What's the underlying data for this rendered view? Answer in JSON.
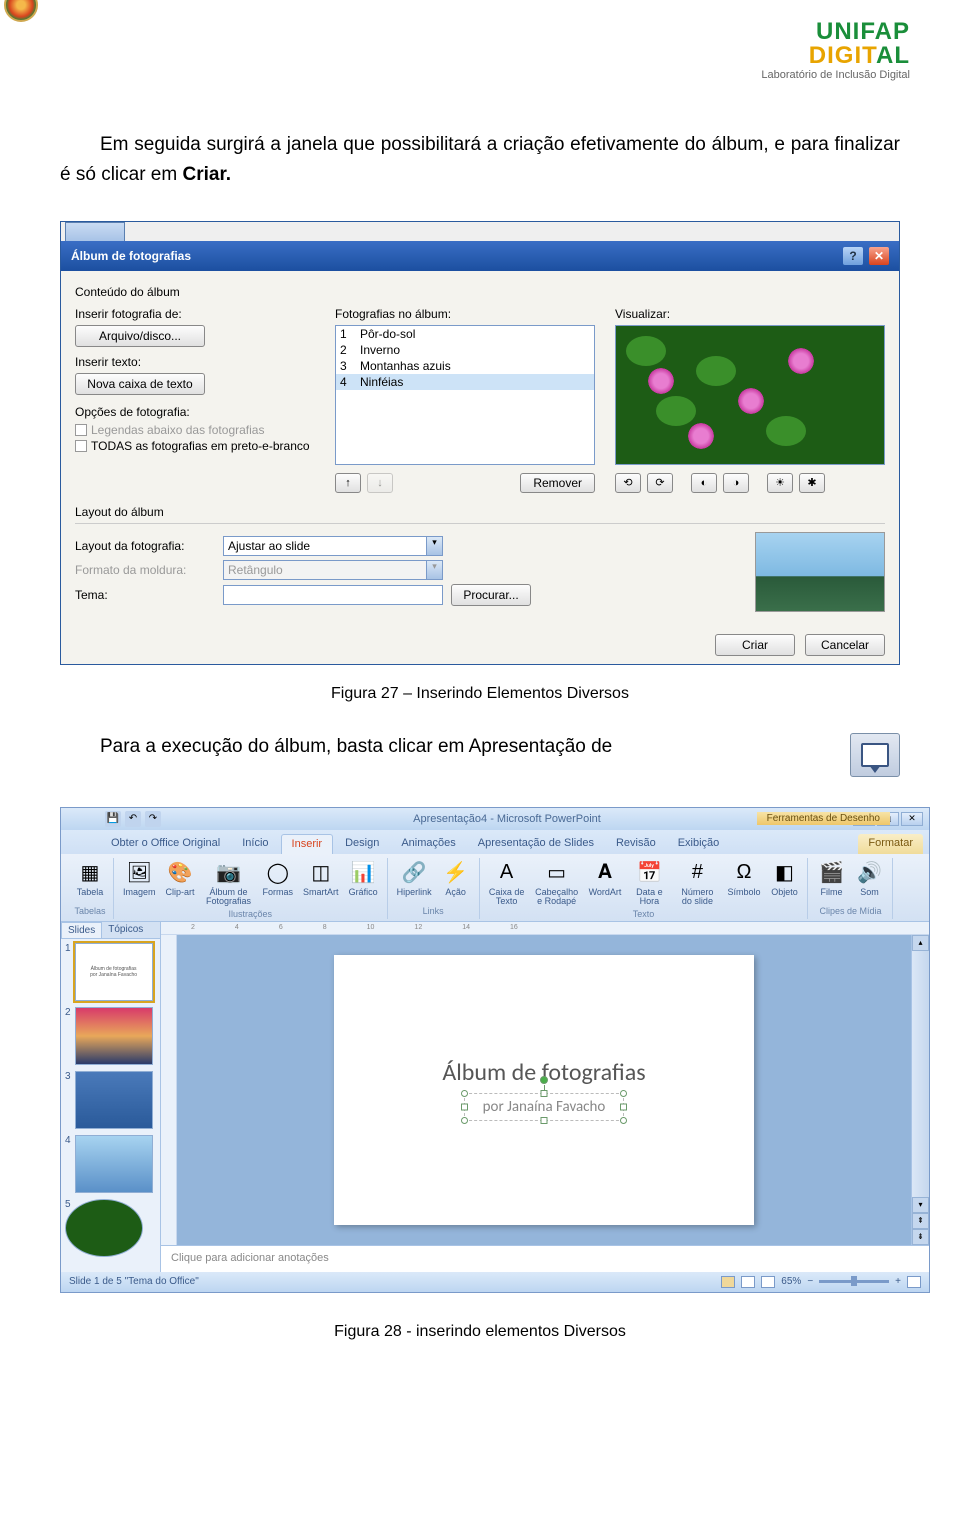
{
  "header": {
    "logo_line1": "UNIFAP",
    "logo_line2_pre": "DIGIT",
    "logo_line2_suf": "AL",
    "subtitle": "Laboratório de Inclusão Digital"
  },
  "paragraph1_pre": "Em seguida surgirá a janela que possibilitará a criação efetivamente do álbum, e para finalizar é só clicar em ",
  "paragraph1_bold": "Criar.",
  "figure27_caption": "Figura 27 – Inserindo Elementos Diversos",
  "paragraph2": "Para a execução do álbum, basta clicar em Apresentação de",
  "figure28_caption": "Figura 28 - inserindo elementos Diversos",
  "dialog": {
    "title": "Álbum de fotografias",
    "groups": {
      "contents": "Conteúdo do álbum",
      "insert_from": "Inserir fotografia de:",
      "insert_text": "Inserir texto:",
      "options": "Opções de fotografia:",
      "photos_in_album": "Fotografias no álbum:",
      "preview": "Visualizar:",
      "layout": "Layout do álbum"
    },
    "buttons": {
      "file": "Arquivo/disco...",
      "newtext": "Nova caixa de texto",
      "remove": "Remover",
      "browse": "Procurar...",
      "create": "Criar",
      "cancel": "Cancelar"
    },
    "checkboxes": {
      "captions": "Legendas abaixo das fotografias",
      "bw": "TODAS as fotografias em preto-e-branco"
    },
    "list": [
      {
        "n": "1",
        "name": "Pôr-do-sol"
      },
      {
        "n": "2",
        "name": "Inverno"
      },
      {
        "n": "3",
        "name": "Montanhas azuis"
      },
      {
        "n": "4",
        "name": "Ninféias"
      }
    ],
    "layout_labels": {
      "picture": "Layout da fotografia:",
      "frame": "Formato da moldura:",
      "theme": "Tema:"
    },
    "layout_values": {
      "picture": "Ajustar ao slide",
      "frame": "Retângulo"
    },
    "arrow_up": "↑",
    "arrow_down": "↓"
  },
  "ppt": {
    "title": "Apresentação4 - Microsoft PowerPoint",
    "context_tab_title": "Ferramentas de Desenho",
    "tabs": [
      "Obter o Office Original",
      "Início",
      "Inserir",
      "Design",
      "Animações",
      "Apresentação de Slides",
      "Revisão",
      "Exibição"
    ],
    "format_tab": "Formatar",
    "ribbon_groups": {
      "tabelas": {
        "label": "Tabelas",
        "items": [
          "Tabela"
        ]
      },
      "ilustracoes": {
        "label": "Ilustrações",
        "items": [
          "Imagem",
          "Clip-art",
          "Álbum de Fotografias",
          "Formas",
          "SmartArt",
          "Gráfico"
        ]
      },
      "links": {
        "label": "Links",
        "items": [
          "Hiperlink",
          "Ação"
        ]
      },
      "texto": {
        "label": "Texto",
        "items": [
          "Caixa de Texto",
          "Cabeçalho e Rodapé",
          "WordArt",
          "Data e Hora",
          "Número do slide",
          "Símbolo",
          "Objeto"
        ]
      },
      "clipes": {
        "label": "Clipes de Mídia",
        "items": [
          "Filme",
          "Som"
        ]
      }
    },
    "left_tabs": {
      "slides": "Slides",
      "topics": "Tópicos"
    },
    "thumbs": [
      {
        "n": "1",
        "variant": "title",
        "t1": "Álbum de fotografias",
        "t2": "por Janaína Favacho"
      },
      {
        "n": "2",
        "variant": "sunset"
      },
      {
        "n": "3",
        "variant": "water"
      },
      {
        "n": "4",
        "variant": "sky"
      },
      {
        "n": "5",
        "variant": "lily"
      }
    ],
    "slide": {
      "title": "Álbum de fotografias",
      "subtitle": "por Janaína Favacho"
    },
    "notes_placeholder": "Clique para adicionar anotações",
    "status": {
      "left": "Slide 1 de 5    \"Tema do Office\"",
      "zoom": "65%"
    },
    "ruler_marks": [
      "2",
      "4",
      "6",
      "8",
      "10",
      "12",
      "14",
      "16"
    ]
  }
}
